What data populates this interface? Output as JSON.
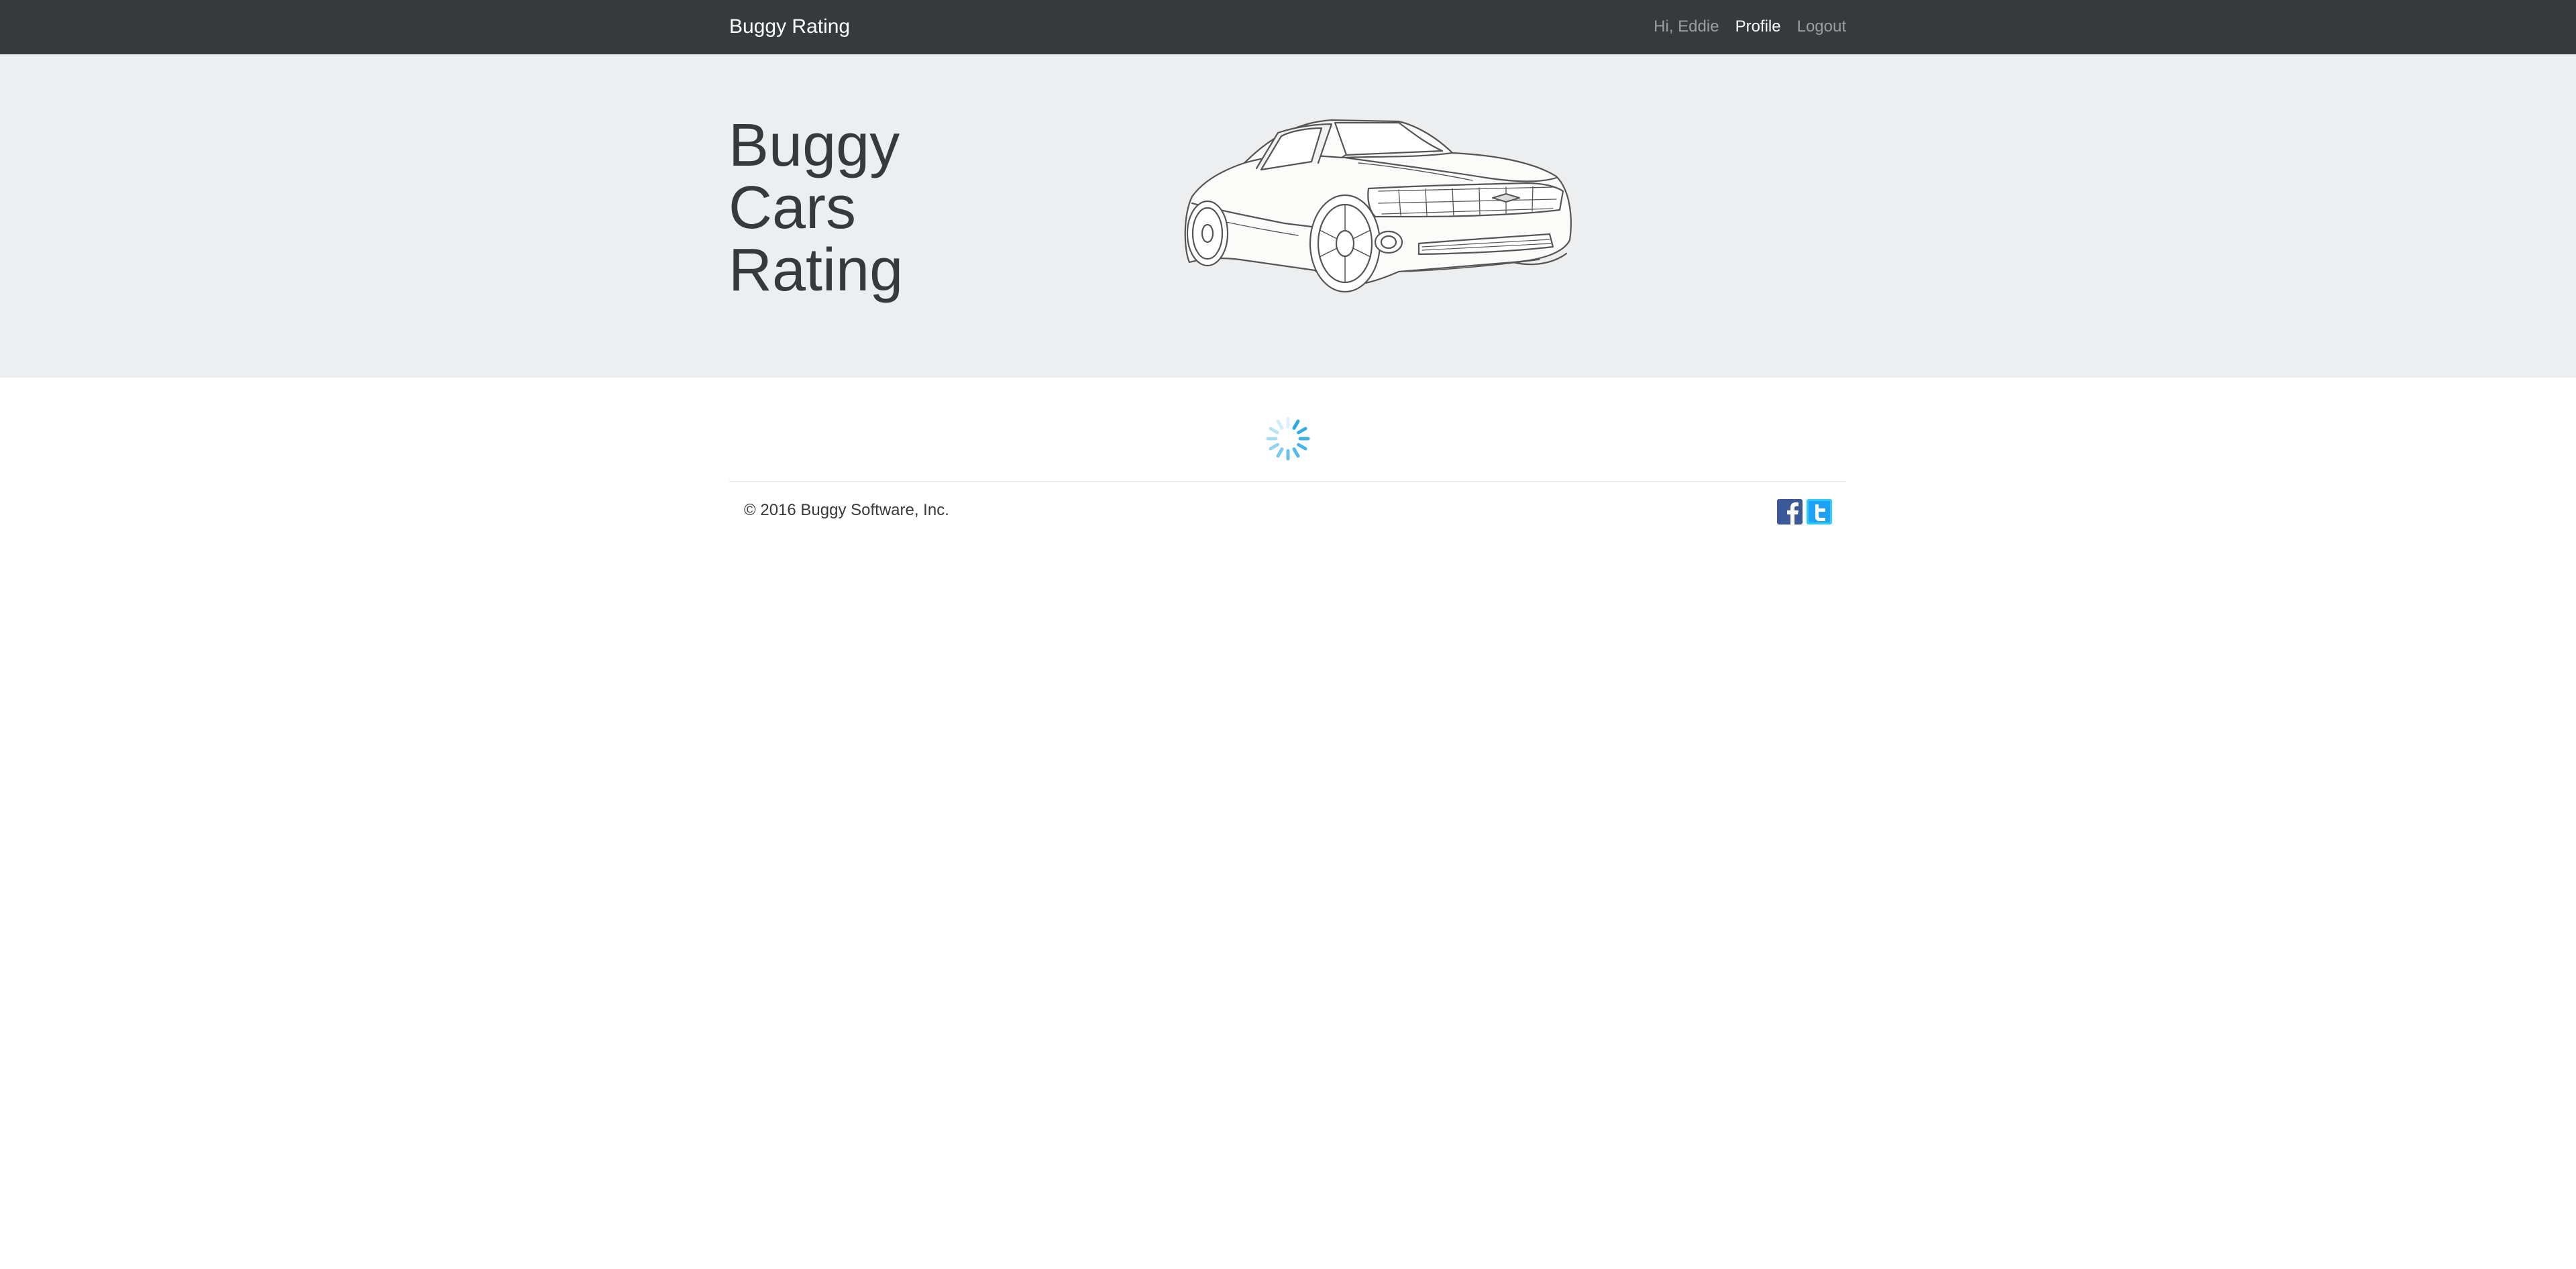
{
  "navbar": {
    "brand": "Buggy Rating",
    "greeting": "Hi, Eddie",
    "profile": "Profile",
    "logout": "Logout"
  },
  "hero": {
    "line1": "Buggy",
    "line2": "Cars",
    "line3": "Rating"
  },
  "footer": {
    "copyright": "© 2016 Buggy Software, Inc.",
    "social": [
      "facebook-icon",
      "twitter-icon"
    ]
  },
  "icons": {
    "loader": "spinner-icon",
    "car": "car-illustration"
  },
  "colors": {
    "navbar_bg": "#373a3c",
    "jumbotron_bg": "#eceeef",
    "spinner": "#29a9e1",
    "facebook": "#3b5998",
    "twitter": "#1da1f2"
  }
}
